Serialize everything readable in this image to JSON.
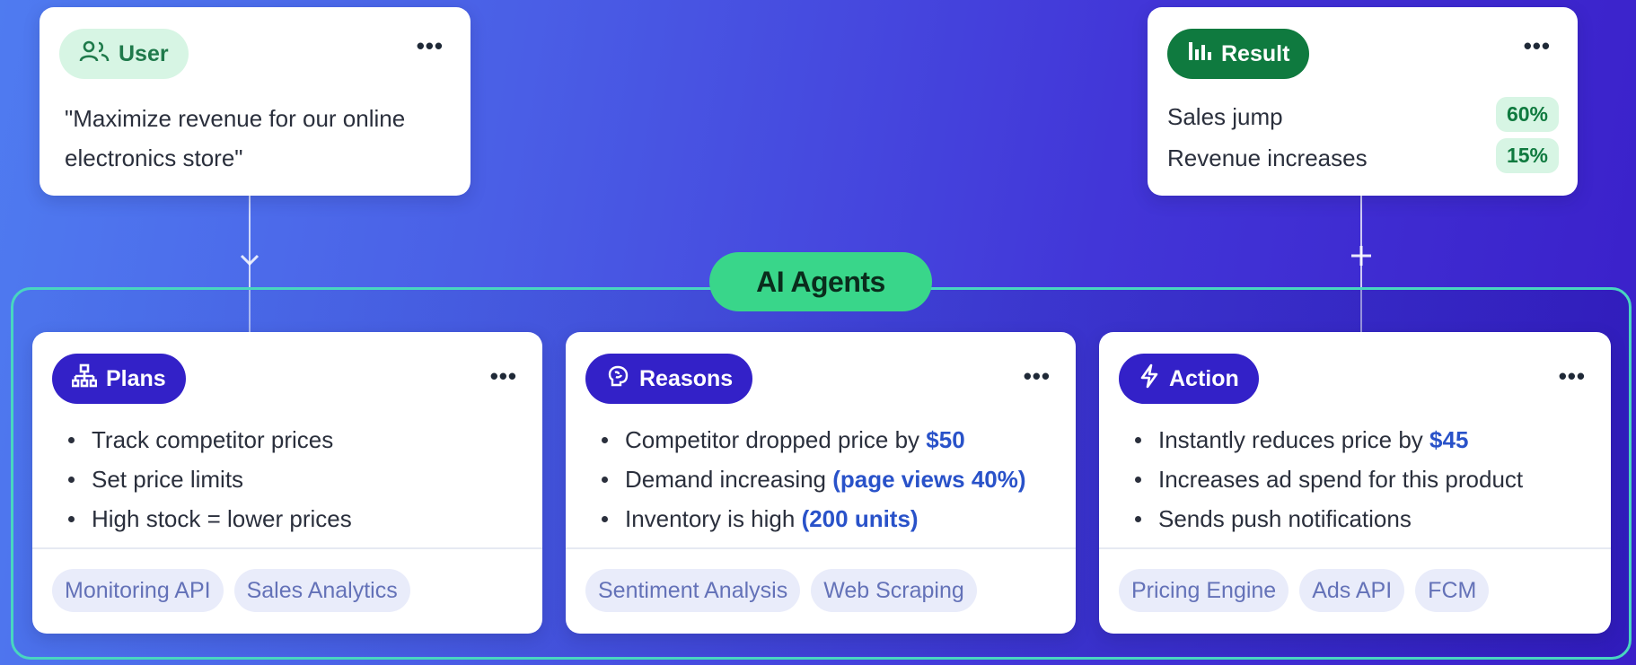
{
  "user": {
    "pill_label": "User",
    "icon": "user-group-icon",
    "quote_line1": "\"Maximize revenue for our online",
    "quote_line2": "electronics store\""
  },
  "result": {
    "pill_label": "Result",
    "icon": "bar-chart-icon",
    "metrics": [
      {
        "label": "Sales jump",
        "value": "60%"
      },
      {
        "label": "Revenue increases",
        "value": "15%"
      }
    ]
  },
  "agents_label": "AI Agents",
  "agents": [
    {
      "title": "Plans",
      "icon": "hierarchy-icon",
      "bullets": [
        {
          "text": "Track competitor prices",
          "highlight": ""
        },
        {
          "text": "Set price limits",
          "highlight": ""
        },
        {
          "text": "High stock = lower prices",
          "highlight": ""
        }
      ],
      "tags": [
        "Monitoring API",
        "Sales Analytics"
      ]
    },
    {
      "title": "Reasons",
      "icon": "brain-icon",
      "bullets": [
        {
          "text": "Competitor dropped price by ",
          "highlight": "$50"
        },
        {
          "text": "Demand increasing ",
          "highlight": "(page views 40%)"
        },
        {
          "text": "Inventory is high ",
          "highlight": "(200 units)"
        }
      ],
      "tags": [
        "Sentiment Analysis",
        "Web Scraping"
      ]
    },
    {
      "title": "Action",
      "icon": "lightning-icon",
      "bullets": [
        {
          "text": "Instantly reduces price by ",
          "highlight": "$45"
        },
        {
          "text": "Increases ad spend for this product",
          "highlight": ""
        },
        {
          "text": "Sends push notifications",
          "highlight": ""
        }
      ],
      "tags": [
        "Pricing Engine",
        "Ads API",
        "FCM"
      ]
    }
  ],
  "colors": {
    "user_pill_bg": "#d7f5e4",
    "user_pill_fg": "#1f7a4b",
    "result_pill_bg": "#0f7a3f",
    "agent_pill_bg": "#3321c8",
    "agents_label_bg": "#39d68a",
    "frame_border": "#48d6c0",
    "highlight": "#2952c9"
  }
}
